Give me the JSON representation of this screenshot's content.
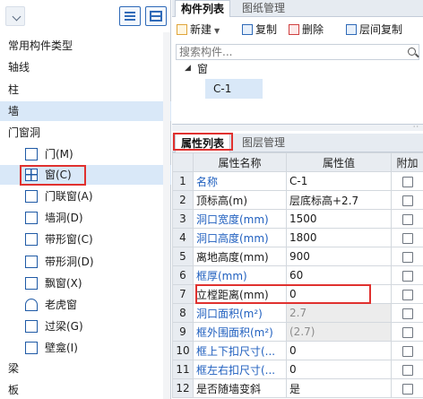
{
  "left_tree": {
    "categories_top": [
      "常用构件类型",
      "轴线",
      "柱",
      "墙",
      "门窗洞"
    ],
    "subitems": [
      {
        "label": "门(M)",
        "icon": "door-icon"
      },
      {
        "label": "窗(C)",
        "icon": "window-icon"
      },
      {
        "label": "门联窗(A)",
        "icon": "door-window-icon"
      },
      {
        "label": "墙洞(D)",
        "icon": "wall-hole-icon"
      },
      {
        "label": "带形窗(C)",
        "icon": "strip-window-icon"
      },
      {
        "label": "带形洞(D)",
        "icon": "strip-hole-icon"
      },
      {
        "label": "飘窗(X)",
        "icon": "bay-window-icon"
      },
      {
        "label": "老虎窗",
        "icon": "dormer-window-icon"
      },
      {
        "label": "过梁(G)",
        "icon": "lintel-icon"
      },
      {
        "label": "壁龛(I)",
        "icon": "niche-icon"
      }
    ],
    "categories_bottom": [
      "梁",
      "板"
    ],
    "selected": "窗(C)",
    "highlight_color": "#d9e8f8",
    "annotation_color": "#e0312f"
  },
  "component_panel": {
    "tabs": [
      "构件列表",
      "图纸管理"
    ],
    "toolbar": {
      "new": "新建",
      "copy": "复制",
      "delete": "删除",
      "floor_copy": "层间复制"
    },
    "search_placeholder": "搜索构件...",
    "tree_group": "窗",
    "tree_item": "C-1"
  },
  "property_panel": {
    "tabs": [
      "属性列表",
      "图层管理"
    ],
    "columns": [
      "属性名称",
      "属性值",
      "附加"
    ],
    "rows": [
      {
        "num": "1",
        "name": "名称",
        "value": "C-1",
        "name_blue": true,
        "value_grey": false
      },
      {
        "num": "2",
        "name": "顶标高(m)",
        "value": "层底标高+2.7",
        "name_blue": false,
        "value_grey": false
      },
      {
        "num": "3",
        "name": "洞口宽度(mm)",
        "value": "1500",
        "name_blue": true,
        "value_grey": false
      },
      {
        "num": "4",
        "name": "洞口高度(mm)",
        "value": "1800",
        "name_blue": true,
        "value_grey": false
      },
      {
        "num": "5",
        "name": "离地高度(mm)",
        "value": "900",
        "name_blue": false,
        "value_grey": false
      },
      {
        "num": "6",
        "name": "框厚(mm)",
        "value": "60",
        "name_blue": true,
        "value_grey": false
      },
      {
        "num": "7",
        "name": "立樘距离(mm)",
        "value": "0",
        "name_blue": false,
        "value_grey": false
      },
      {
        "num": "8",
        "name": "洞口面积(m²)",
        "value": "2.7",
        "name_blue": true,
        "value_grey": true
      },
      {
        "num": "9",
        "name": "框外围面积(m²)",
        "value": "(2.7)",
        "name_blue": true,
        "value_grey": true
      },
      {
        "num": "10",
        "name": "框上下扣尺寸(...",
        "value": "0",
        "name_blue": true,
        "value_grey": false
      },
      {
        "num": "11",
        "name": "框左右扣尺寸(...",
        "value": "0",
        "name_blue": true,
        "value_grey": false
      },
      {
        "num": "12",
        "name": "是否随墙变斜",
        "value": "是",
        "name_blue": false,
        "value_grey": false
      }
    ],
    "highlighted_row": "7"
  }
}
